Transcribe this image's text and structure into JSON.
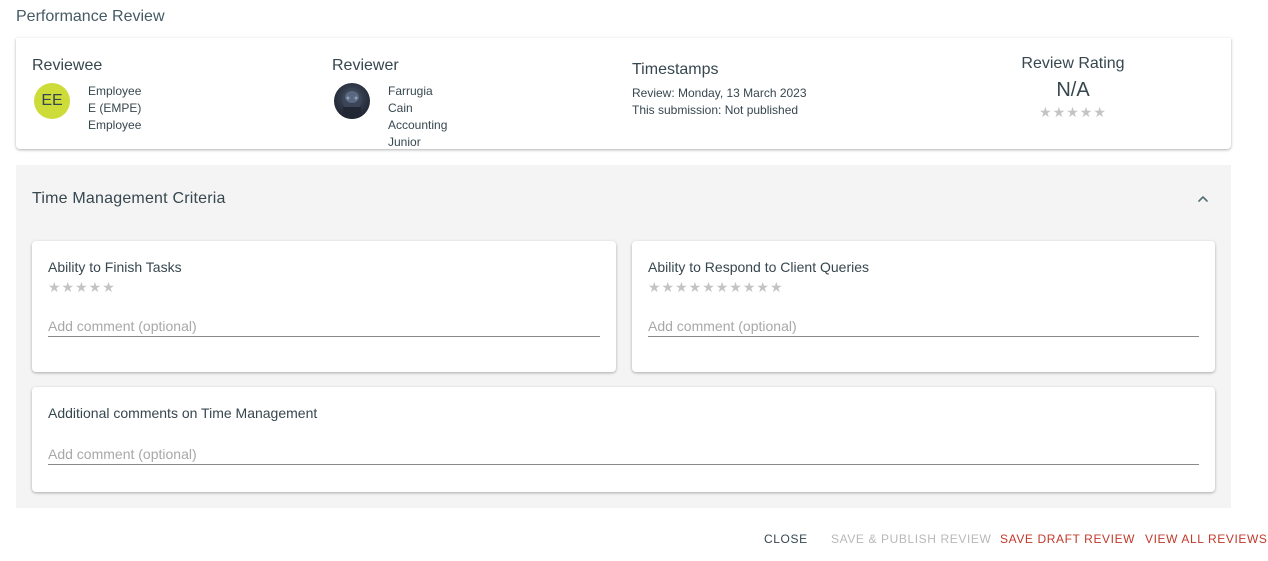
{
  "page": {
    "title": "Performance Review"
  },
  "summary": {
    "reviewee": {
      "heading": "Reviewee",
      "initials": "EE",
      "name": "Employee E (EMPE)",
      "role": "Employee"
    },
    "reviewer": {
      "heading": "Reviewer",
      "name": "Farrugia Cain",
      "role": "Accounting Junior"
    },
    "timestamps": {
      "heading": "Timestamps",
      "review": "Review: Monday, 13 March 2023",
      "submission": "This submission: Not published"
    },
    "rating": {
      "heading": "Review Rating",
      "value": "N/A",
      "stars": "★★★★★",
      "stars_filled": 0,
      "stars_total": 5
    }
  },
  "criteria": {
    "title": "Time Management Criteria",
    "expanded": true,
    "items": [
      {
        "label": "Ability to Finish Tasks",
        "stars": "★★★★★",
        "stars_filled": 0,
        "stars_total": 5,
        "comment_placeholder": "Add comment (optional)"
      },
      {
        "label": "Ability to Respond to Client Queries",
        "stars": "★★★★★★★★★★",
        "stars_filled": 0,
        "stars_total": 10,
        "comment_placeholder": "Add comment (optional)"
      }
    ],
    "additional": {
      "label": "Additional comments on Time Management",
      "comment_placeholder": "Add comment (optional)"
    }
  },
  "actions": {
    "close": "CLOSE",
    "save_publish": "SAVE & PUBLISH REVIEW",
    "save_draft": "SAVE DRAFT REVIEW",
    "view_all": "VIEW ALL REVIEWS"
  },
  "colors": {
    "accent_red": "#c0392b",
    "avatar_bg": "#cddc39",
    "star_empty": "#c4c4c4",
    "disabled_text": "#b8b8b8"
  },
  "icons": {
    "collapse": "chevron-up-icon",
    "star": "star-icon"
  }
}
